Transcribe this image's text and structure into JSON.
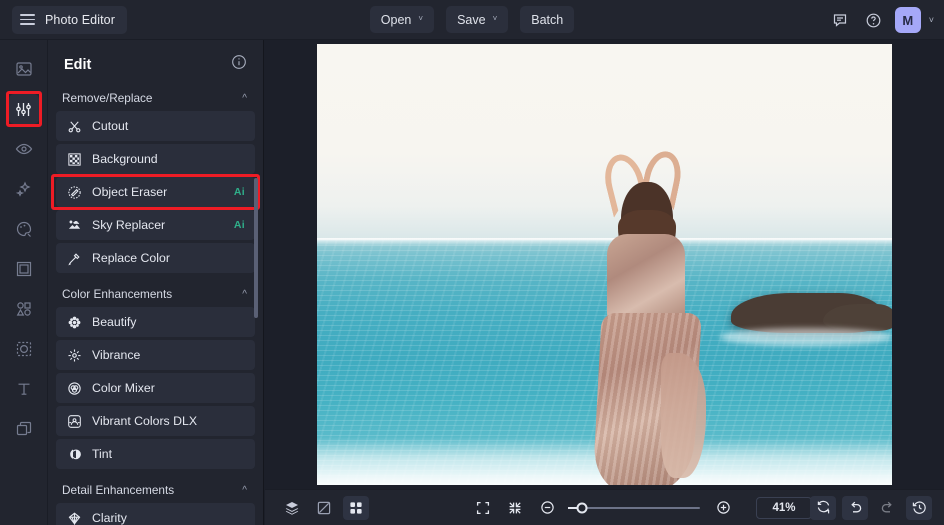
{
  "app": {
    "title": "Photo Editor",
    "accent_purple": "#a5a8f8",
    "highlight_red": "#ee1c25",
    "ai_badge_green": "#2fb08a",
    "panel_bg": "#22252f",
    "canvas_bg": "#1c1f29"
  },
  "topbar": {
    "menu_icon": "hamburger-icon",
    "buttons": [
      {
        "label": "Open",
        "caret": "˅",
        "name": "open-button"
      },
      {
        "label": "Save",
        "caret": "˅",
        "name": "save-button"
      },
      {
        "label": "Batch",
        "caret": "",
        "name": "batch-button"
      }
    ],
    "feedback_icon": "feedback-icon",
    "help_icon": "help-icon",
    "avatar_initial": "M",
    "avatar_caret": "˅"
  },
  "rail": {
    "items": [
      {
        "icon": "image-icon",
        "selected": false
      },
      {
        "icon": "adjust-sliders-icon",
        "selected": true
      },
      {
        "icon": "eye-icon",
        "selected": false
      },
      {
        "icon": "sparkle-icon",
        "selected": false
      },
      {
        "icon": "palette-icon",
        "selected": false
      },
      {
        "icon": "frame-icon",
        "selected": false
      },
      {
        "icon": "shapes-icon",
        "selected": false
      },
      {
        "icon": "sticker-icon",
        "selected": false
      },
      {
        "icon": "text-icon",
        "selected": false
      },
      {
        "icon": "layers-copy-icon",
        "selected": false
      }
    ]
  },
  "panel": {
    "title": "Edit",
    "info_icon": "info-icon",
    "sections": [
      {
        "name": "Remove/Replace",
        "collapse_icon": "chevron-up-icon",
        "items": [
          {
            "label": "Cutout",
            "icon": "scissors-icon",
            "badge": "",
            "selected": false
          },
          {
            "label": "Background",
            "icon": "checkerboard-icon",
            "badge": "",
            "selected": false
          },
          {
            "label": "Object Eraser",
            "icon": "eraser-icon",
            "badge": "Ai",
            "selected": true
          },
          {
            "label": "Sky Replacer",
            "icon": "sky-icon",
            "badge": "Ai",
            "selected": false
          },
          {
            "label": "Replace Color",
            "icon": "dropper-icon",
            "badge": "",
            "selected": false
          }
        ]
      },
      {
        "name": "Color Enhancements",
        "collapse_icon": "chevron-up-icon",
        "items": [
          {
            "label": "Beautify",
            "icon": "flower-icon",
            "badge": "",
            "selected": false
          },
          {
            "label": "Vibrance",
            "icon": "burst-icon",
            "badge": "",
            "selected": false
          },
          {
            "label": "Color Mixer",
            "icon": "mixer-icon",
            "badge": "",
            "selected": false
          },
          {
            "label": "Vibrant Colors DLX",
            "icon": "vibrant-icon",
            "badge": "",
            "selected": false
          },
          {
            "label": "Tint",
            "icon": "tint-icon",
            "badge": "",
            "selected": false
          }
        ]
      },
      {
        "name": "Detail Enhancements",
        "collapse_icon": "chevron-up-icon",
        "items": [
          {
            "label": "Clarity",
            "icon": "diamond-icon",
            "badge": "",
            "selected": false
          }
        ]
      }
    ]
  },
  "bottombar": {
    "left_tools": [
      {
        "icon": "layers-icon",
        "active": false
      },
      {
        "icon": "compare-icon",
        "active": false
      },
      {
        "icon": "grid-icon",
        "active": true
      }
    ],
    "view_tools": [
      {
        "icon": "fit-screen-icon"
      },
      {
        "icon": "shrink-icon"
      }
    ],
    "zoom_out_icon": "zoom-out-icon",
    "zoom_in_icon": "zoom-in-icon",
    "zoom_level": "41%",
    "right_tools": [
      {
        "icon": "reset-icon",
        "dim": false
      },
      {
        "icon": "undo-icon",
        "dim": false
      },
      {
        "icon": "redo-icon",
        "dim": true
      },
      {
        "icon": "history-icon",
        "dim": false
      }
    ]
  }
}
